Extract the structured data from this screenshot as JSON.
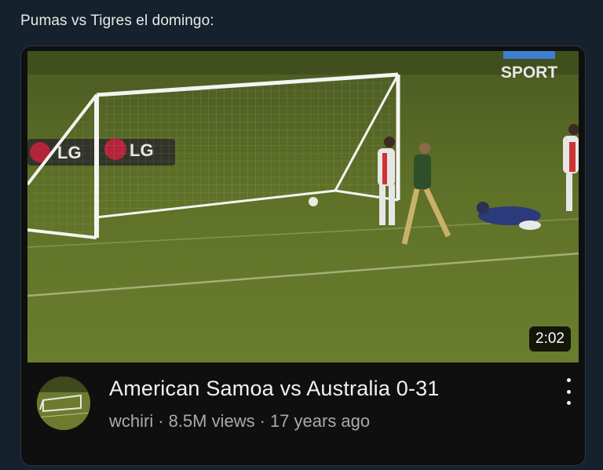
{
  "tweet": {
    "text": "Pumas vs Tigres el domingo:"
  },
  "video": {
    "channel_watermark": "SPORT",
    "sponsor_text_1": "LG",
    "sponsor_text_2": "LG",
    "duration": "2:02",
    "title": "American Samoa vs Australia 0-31",
    "channel": "wchiri",
    "separator": "·",
    "views": "8.5M views",
    "age": "17 years ago",
    "more_icon": "vertical-ellipsis-icon"
  },
  "colors": {
    "page_background": "#15212c",
    "card_background": "#0f0f0f",
    "pitch": "#5a6b2a",
    "title_text": "#f1f1f1",
    "subline_text": "#aaaaaa"
  }
}
